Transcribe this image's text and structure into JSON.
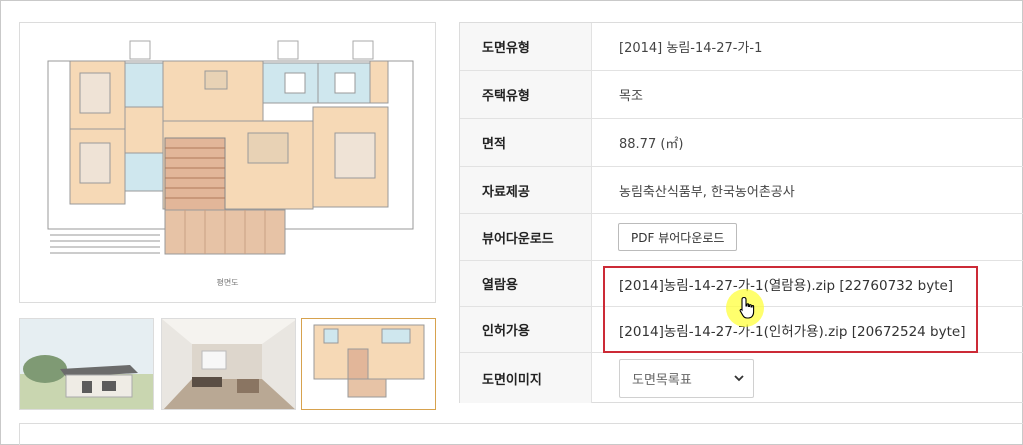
{
  "main_image": {
    "caption": "평면도"
  },
  "thumbnails": [
    {
      "kind": "exterior-render"
    },
    {
      "kind": "interior-render"
    },
    {
      "kind": "floor-plan",
      "selected": true
    }
  ],
  "info": {
    "rows": [
      {
        "label": "도면유형",
        "value": "[2014] 농림-14-27-가-1"
      },
      {
        "label": "주택유형",
        "value": "목조"
      },
      {
        "label": "면적",
        "value": "88.77 (㎡)"
      },
      {
        "label": "자료제공",
        "value": "농림축산식품부, 한국농어촌공사"
      },
      {
        "label": "뷰어다운로드",
        "button": "PDF 뷰어다운로드"
      },
      {
        "label": "열람용",
        "value": "[2014]농림-14-27-가-1(열람용).zip [22760732 byte]"
      },
      {
        "label": "인허가용",
        "value": "[2014]농림-14-27-가-1(인허가용).zip [20672524 byte]"
      },
      {
        "label": "도면이미지",
        "select_value": "도면목록표"
      }
    ]
  },
  "colors": {
    "highlight": "#cc2a36",
    "selected_thumb_border": "#d7a24e",
    "cursor_glow": "#ffff3c"
  }
}
